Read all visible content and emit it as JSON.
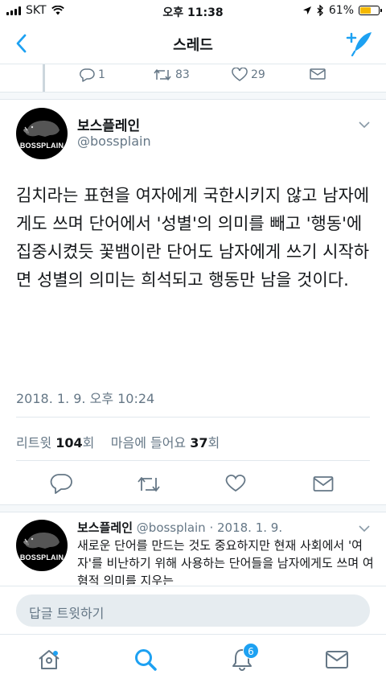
{
  "status_bar": {
    "carrier": "SKT",
    "time": "오후 11:38",
    "battery": "61%",
    "battery_level": 0.61
  },
  "nav": {
    "title": "스레드",
    "back_icon": "chevron-left-icon",
    "compose_icon": "compose-tweet-icon"
  },
  "previous_tweet": {
    "replies": "1",
    "retweets": "83",
    "likes": "29"
  },
  "main_tweet": {
    "name": "보스플레인",
    "handle": "@bossplain",
    "avatar_text": "BOSSPLAIN",
    "text": "김치라는 표현을 여자에게 국한시키지 않고 남자에게도 쓰며 단어에서 '성별'의 의미를 빼고 '행동'에 집중시켰듯 꽃뱀이란 단어도 남자에게 쓰기 시작하면 성별의 의미는 희석되고 행동만 남을 것이다.",
    "timestamp": "2018. 1. 9. 오후 10:24",
    "retweet_label": "리트윗",
    "retweet_count": "104",
    "retweet_unit": "회",
    "like_label": "마음에 들어요",
    "like_count": "37",
    "like_unit": "회"
  },
  "reply_tweet": {
    "name": "보스플레인",
    "handle_date": "@bossplain · 2018. 1. 9.",
    "avatar_text": "BOSSPLAIN",
    "text": "새로운 단어를 만드는 것도 중요하지만 현재 사회에서 '여자'를 비난하기 위해 사용하는 단어들을 남자에게도 쓰며 여혐적 의미를 지우는"
  },
  "reply_bar": {
    "placeholder": "답글 트윗하기"
  },
  "tab_bar": {
    "items": [
      "home-icon",
      "search-icon",
      "notifications-icon",
      "messages-icon"
    ],
    "notification_badge": "6"
  },
  "colors": {
    "accent": "#1da1f2",
    "secondary_text": "#657786",
    "divider": "#e1e8ed"
  }
}
